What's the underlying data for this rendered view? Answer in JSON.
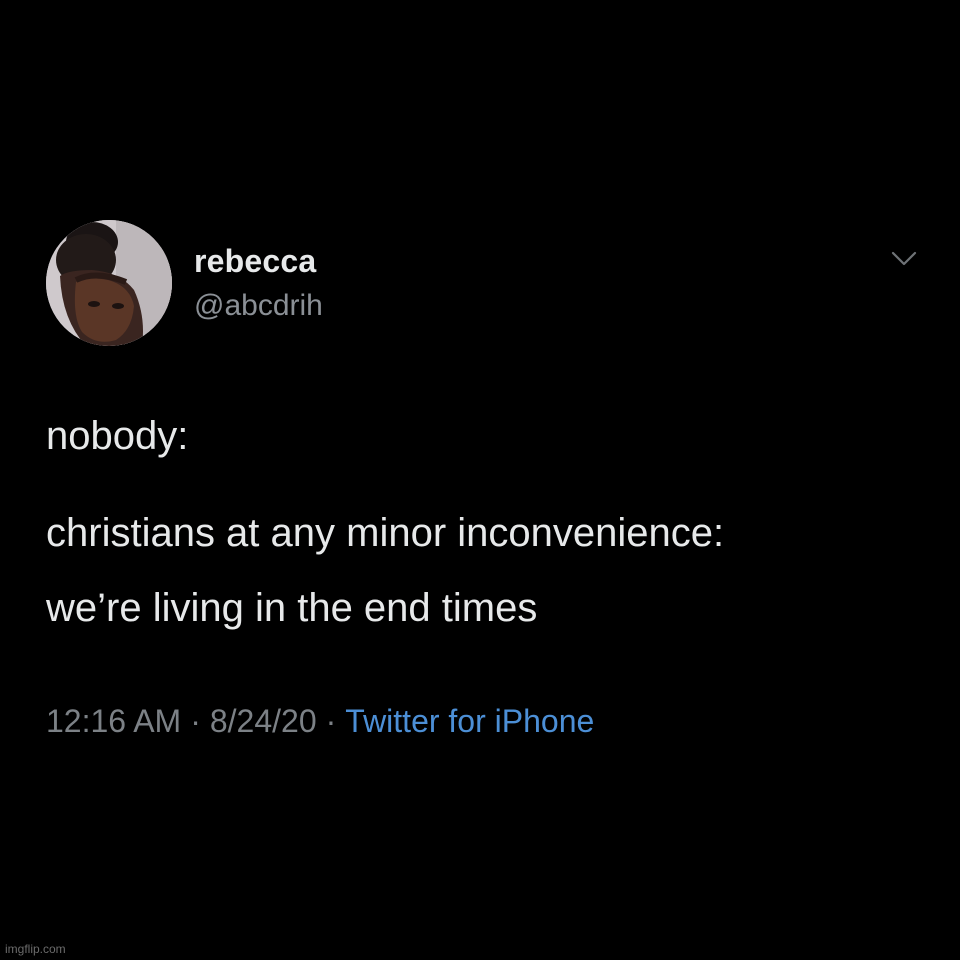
{
  "tweet": {
    "author": {
      "display_name": "rebecca",
      "handle": "@abcdrih",
      "avatar_icon": "profile-photo"
    },
    "menu_icon": "chevron-down-icon",
    "body_lines": [
      "nobody:",
      "christians at any minor inconvenience:",
      "we’re living in the end times"
    ],
    "meta": {
      "time": "12:16 AM",
      "date": "8/24/20",
      "separator": "·",
      "source": "Twitter for iPhone"
    }
  },
  "watermark": "imgflip.com",
  "colors": {
    "background": "#000000",
    "primary_text": "#e7e9ea",
    "secondary_text": "#8b9096",
    "link": "#4c8fd6"
  }
}
